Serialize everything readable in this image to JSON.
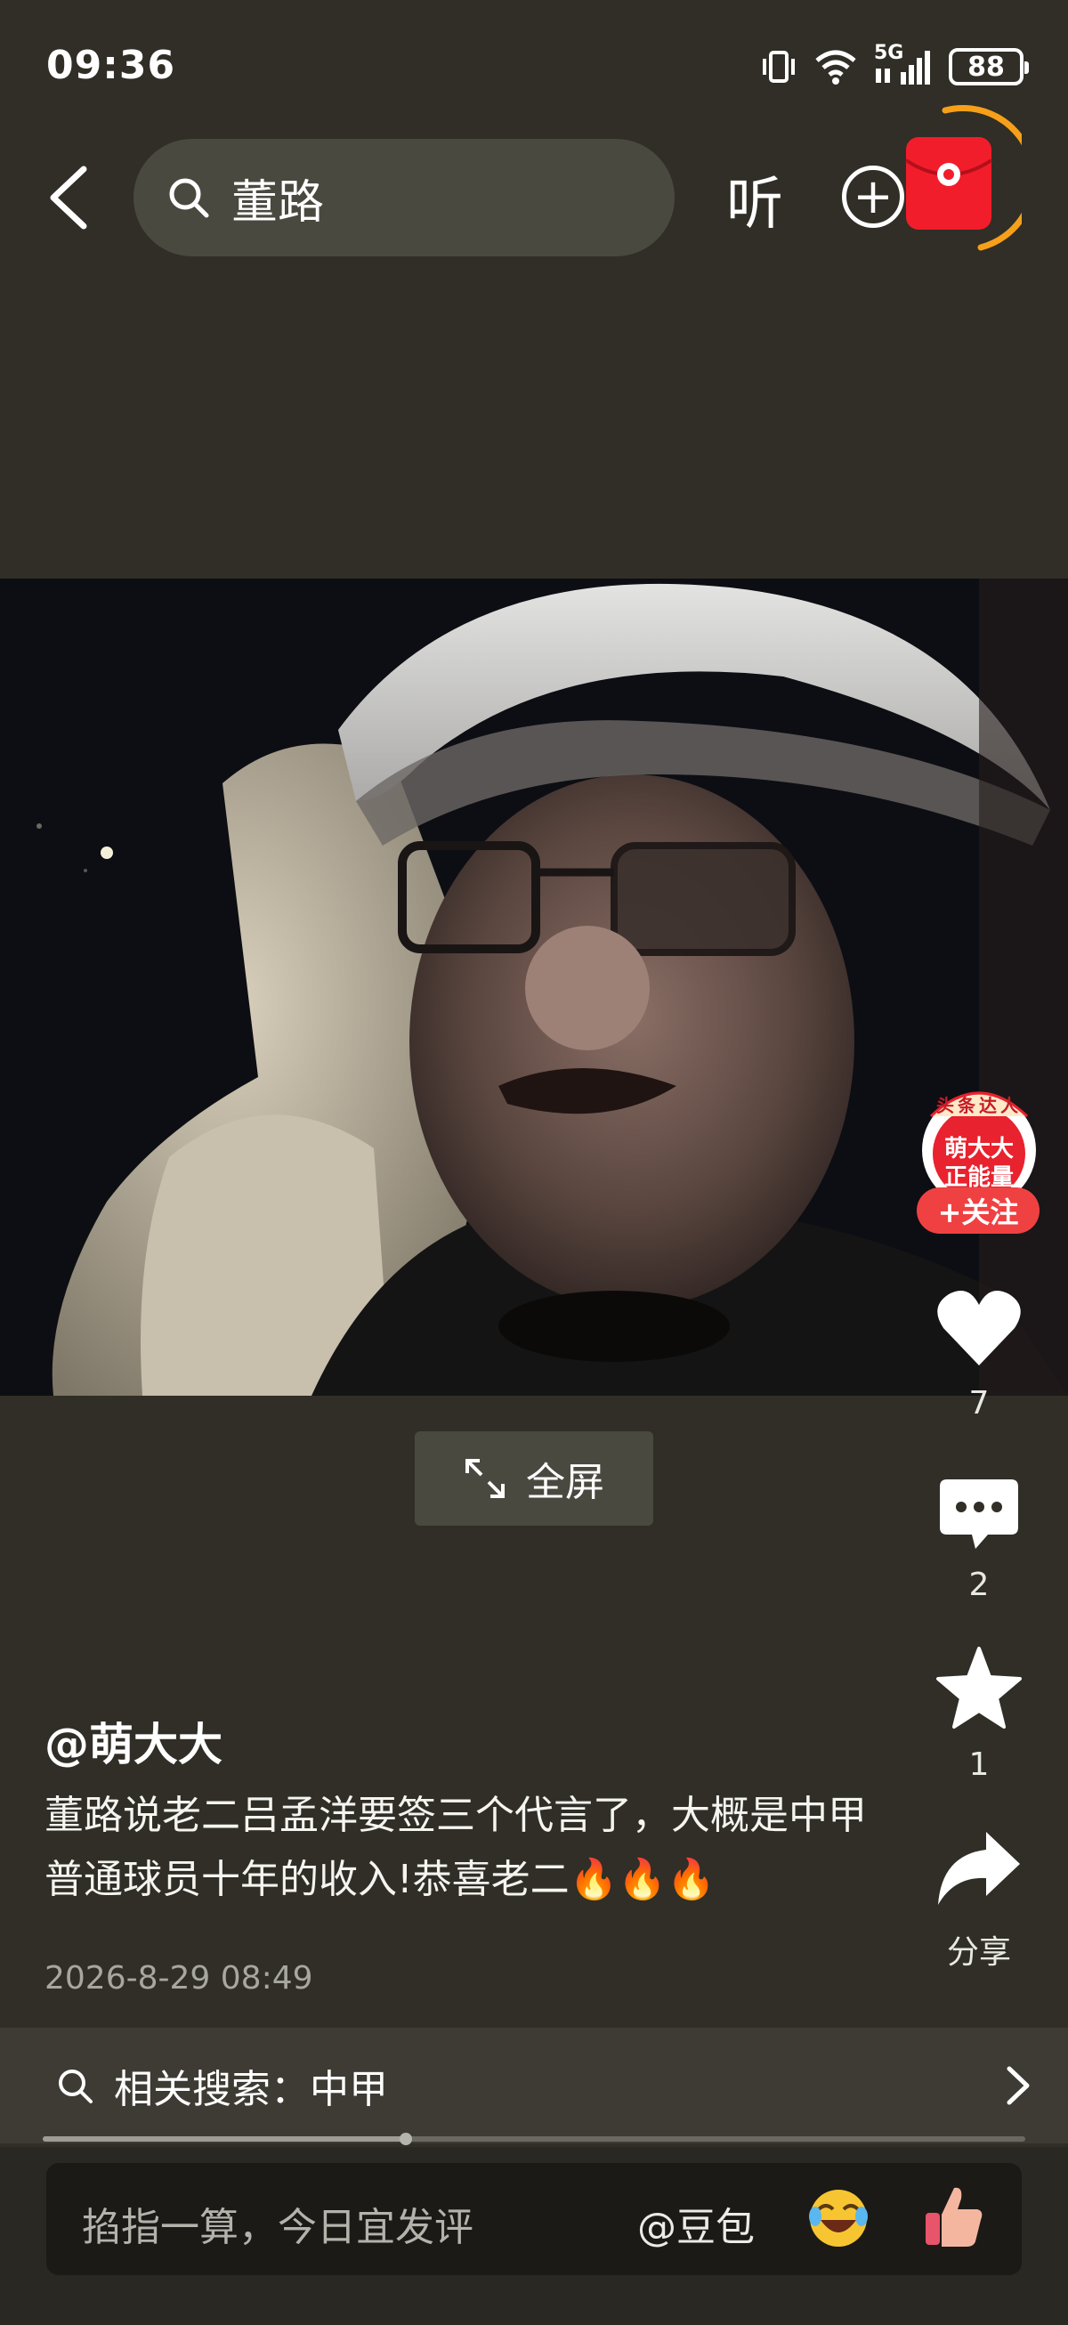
{
  "status": {
    "time": "09:36",
    "network": "5G",
    "battery": "88"
  },
  "search": {
    "query": "董路"
  },
  "header": {
    "listen_label": "听"
  },
  "video": {
    "fullscreen_label": "全屏"
  },
  "author": {
    "badge_top": "头条达人",
    "badge_name": "萌大大",
    "badge_sub": "正能量",
    "follow_label": "+关注",
    "handle": "@萌大大"
  },
  "actions": {
    "likes": "7",
    "comments": "2",
    "favorites": "1",
    "share_label": "分享"
  },
  "post": {
    "caption": "董路说老二吕孟洋要签三个代言了，大概是中甲普通球员十年的收入!恭喜老二🔥🔥🔥",
    "time": "2026-8-29 08:49"
  },
  "related": {
    "label": "相关搜索：中甲"
  },
  "playback": {
    "progress": 0.37
  },
  "comment_bar": {
    "placeholder": "掐指一算，今日宜发评",
    "mention": "@豆包"
  },
  "colors": {
    "background": "#302e26",
    "accent": "#f04142",
    "progress": "#9d9c95"
  }
}
